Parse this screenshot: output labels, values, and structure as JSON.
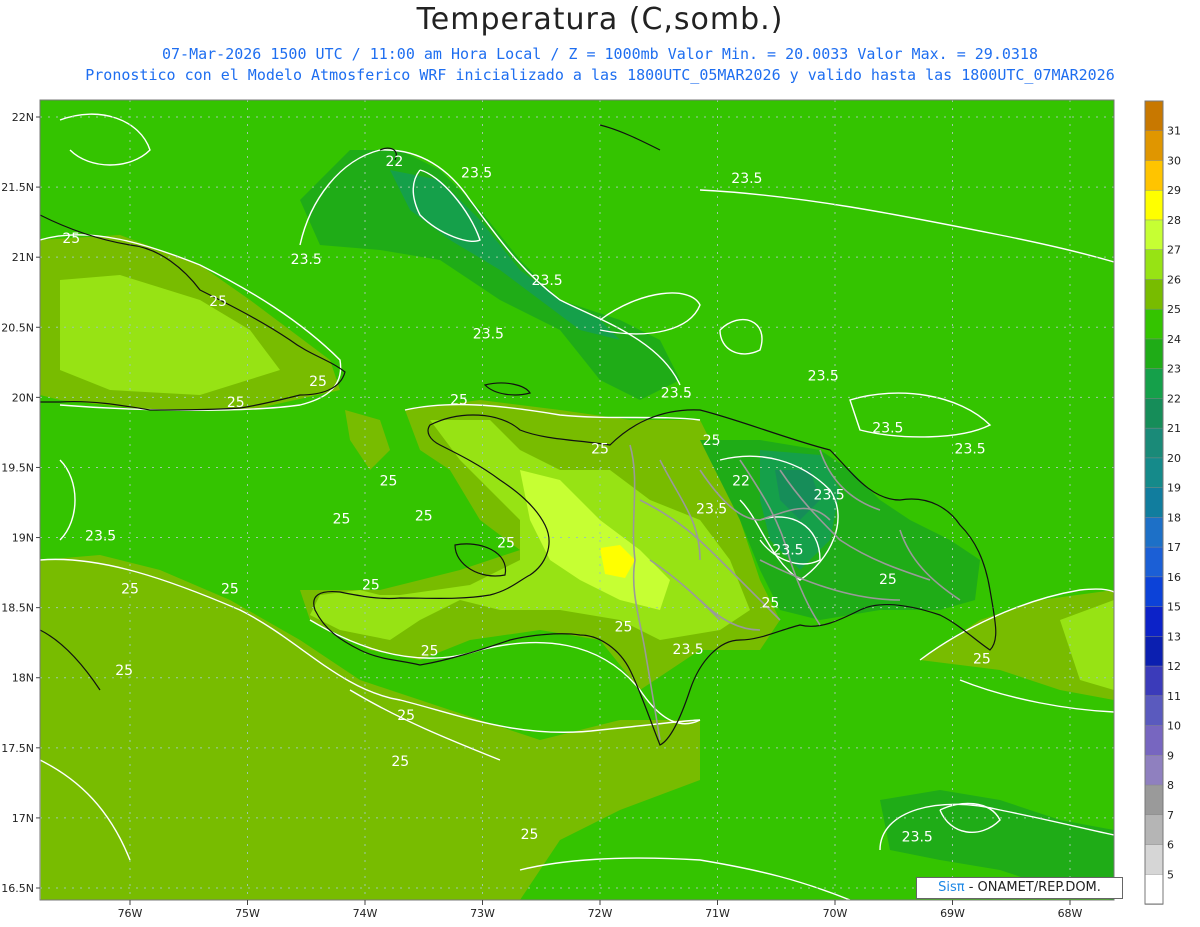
{
  "header": {
    "title": "Temperatura (C,somb.)",
    "line1": "07-Mar-2026 1500 UTC / 11:00 am Hora Local / Z = 1000mb  Valor Min. = 20.0033  Valor Max. = 29.0318",
    "line2": "Pronostico con el Modelo Atmosferico WRF inicializado a las 1800UTC_05MAR2026 y valido hasta las  1800UTC_07MAR2026"
  },
  "map": {
    "lat_labels": [
      "22N",
      "21.5N",
      "21N",
      "20.5N",
      "20N",
      "19.5N",
      "19N",
      "18.5N",
      "18N",
      "17.5N",
      "17N",
      "16.5N"
    ],
    "lon_labels": [
      "76W",
      "75W",
      "74W",
      "73W",
      "72W",
      "71W",
      "70W",
      "69W",
      "68W"
    ],
    "lat_values": [
      22,
      21.5,
      21,
      20.5,
      20,
      19.5,
      19,
      18.5,
      18,
      17.5,
      17,
      16.5
    ],
    "lon_values": [
      -76,
      -75,
      -74,
      -73,
      -72,
      -71,
      -70,
      -69,
      -68
    ],
    "contour_labels": [
      {
        "text": "22",
        "lon": -73.75,
        "lat": 21.65
      },
      {
        "text": "23.5",
        "lon": -73.05,
        "lat": 21.57
      },
      {
        "text": "23.5",
        "lon": -70.75,
        "lat": 21.53
      },
      {
        "text": "25",
        "lon": -76.5,
        "lat": 21.1
      },
      {
        "text": "23.5",
        "lon": -74.5,
        "lat": 20.95
      },
      {
        "text": "23.5",
        "lon": -72.45,
        "lat": 20.8
      },
      {
        "text": "25",
        "lon": -75.25,
        "lat": 20.65
      },
      {
        "text": "23.5",
        "lon": -72.95,
        "lat": 20.42
      },
      {
        "text": "23.5",
        "lon": -70.1,
        "lat": 20.12
      },
      {
        "text": "25",
        "lon": -74.4,
        "lat": 20.08
      },
      {
        "text": "25",
        "lon": -75.1,
        "lat": 19.93
      },
      {
        "text": "25",
        "lon": -73.2,
        "lat": 19.95
      },
      {
        "text": "23.5",
        "lon": -71.35,
        "lat": 20.0
      },
      {
        "text": "23.5",
        "lon": -69.55,
        "lat": 19.75
      },
      {
        "text": "23.5",
        "lon": -68.85,
        "lat": 19.6
      },
      {
        "text": "25",
        "lon": -72,
        "lat": 19.6
      },
      {
        "text": "25",
        "lon": -71.05,
        "lat": 19.66
      },
      {
        "text": "22",
        "lon": -70.8,
        "lat": 19.37
      },
      {
        "text": "23.5",
        "lon": -70.05,
        "lat": 19.27
      },
      {
        "text": "25",
        "lon": -73.8,
        "lat": 19.37
      },
      {
        "text": "25",
        "lon": -74.2,
        "lat": 19.1
      },
      {
        "text": "25",
        "lon": -73.5,
        "lat": 19.12
      },
      {
        "text": "23.5",
        "lon": -76.25,
        "lat": 18.98
      },
      {
        "text": "23.5",
        "lon": -71.05,
        "lat": 19.17
      },
      {
        "text": "25",
        "lon": -72.8,
        "lat": 18.93
      },
      {
        "text": "23.5",
        "lon": -70.4,
        "lat": 18.88
      },
      {
        "text": "25",
        "lon": -76,
        "lat": 18.6
      },
      {
        "text": "25",
        "lon": -75.15,
        "lat": 18.6
      },
      {
        "text": "25",
        "lon": -73.95,
        "lat": 18.63
      },
      {
        "text": "25",
        "lon": -69.55,
        "lat": 18.67
      },
      {
        "text": "25",
        "lon": -70.55,
        "lat": 18.5
      },
      {
        "text": "25",
        "lon": -71.8,
        "lat": 18.33
      },
      {
        "text": "25",
        "lon": -73.45,
        "lat": 18.16
      },
      {
        "text": "23.5",
        "lon": -71.25,
        "lat": 18.17
      },
      {
        "text": "25",
        "lon": -68.75,
        "lat": 18.1
      },
      {
        "text": "25",
        "lon": -76.05,
        "lat": 18.02
      },
      {
        "text": "25",
        "lon": -73.65,
        "lat": 17.7
      },
      {
        "text": "25",
        "lon": -73.7,
        "lat": 17.37
      },
      {
        "text": "25",
        "lon": -72.6,
        "lat": 16.85
      },
      {
        "text": "23.5",
        "lon": -69.3,
        "lat": 16.83
      }
    ]
  },
  "legend": {
    "labels": [
      "31",
      "30",
      "29",
      "28",
      "27",
      "26",
      "25",
      "24",
      "23",
      "22",
      "21",
      "20",
      "19",
      "18",
      "17",
      "16",
      "15",
      "13",
      "12",
      "11",
      "10",
      "9",
      "8",
      "7",
      "6",
      "5"
    ],
    "colors": [
      "#c87800",
      "#e09600",
      "#ffc400",
      "#ffff00",
      "#c6ff33",
      "#97e314",
      "#78bc00",
      "#34c400",
      "#1fac17",
      "#15a04a",
      "#168d59",
      "#1a8a78",
      "#158a8a",
      "#117d9e",
      "#1d70c7",
      "#1b5fd6",
      "#0c42d8",
      "#0c22c8",
      "#0b1fb0",
      "#3b3bba",
      "#5a5abe",
      "#7766c0",
      "#8f80bf",
      "#9a9a9a",
      "#b5b5b5",
      "#d6d6d6",
      "#ffffff"
    ]
  },
  "credit": {
    "brand": "Sisπ",
    "text": " - ONAMET/REP.DOM."
  }
}
